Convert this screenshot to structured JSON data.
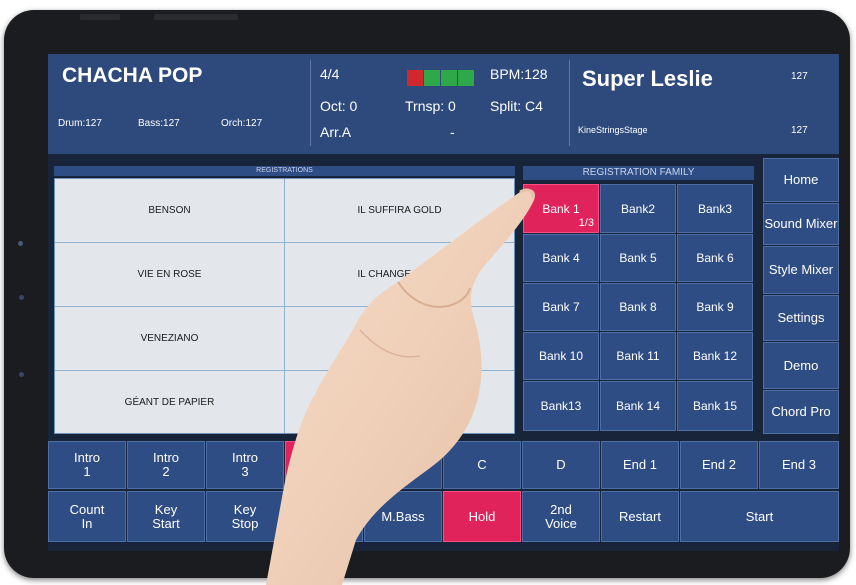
{
  "header": {
    "style_name": "CHACHA POP",
    "drum": "Drum:127",
    "bass": "Bass:127",
    "orch": "Orch:127",
    "time_sig": "4/4",
    "octave": "Oct: 0",
    "arrangement": "Arr.A",
    "transpose": "Trnsp: 0",
    "dash": "-",
    "bpm": "BPM:128",
    "split": "Split: C4",
    "voice_name": "Super Leslie",
    "voice_sub": "KineStringsStage",
    "voice_vol_top": "127",
    "voice_vol_bottom": "127",
    "leds": [
      "#d0282d",
      "#2fa84a",
      "#2fa84a",
      "#2fa84a"
    ]
  },
  "registrations": {
    "title": "REGISTRATIONS",
    "items": [
      "BENSON",
      "IL SUFFIRA GOLD",
      "VIE EN ROSE",
      "IL CHANGEAIT LA",
      "VENEZIANO",
      "",
      "GÉANT DE PAPIER",
      ""
    ]
  },
  "family": {
    "title": "REGISTRATION FAMILY",
    "banks": [
      "Bank 1",
      "Bank2",
      "Bank3",
      "Bank 4",
      "Bank 5",
      "Bank 6",
      "Bank 7",
      "Bank 8",
      "Bank 9",
      "Bank 10",
      "Bank 11",
      "Bank 12",
      "Bank13",
      "Bank 14",
      "Bank 15"
    ],
    "selected_page": "1/3"
  },
  "side_menu": [
    "Home",
    "Sound Mixer",
    "Style Mixer",
    "Settings",
    "Demo",
    "Chord Pro"
  ],
  "controls_row1": [
    "Intro\n1",
    "Intro\n2",
    "Intro\n3",
    "",
    "",
    "C",
    "D",
    "End 1",
    "End 2",
    "End 3"
  ],
  "controls_row2": [
    "Count\nIn",
    "Key\nStart",
    "Key\nStop",
    "",
    "M.Bass",
    "Hold",
    "2nd\nVoice",
    "Restart",
    "Start"
  ],
  "colors": {
    "accent": "#e0245b",
    "panel": "#2f4d85",
    "header": "#2e4a7c"
  }
}
